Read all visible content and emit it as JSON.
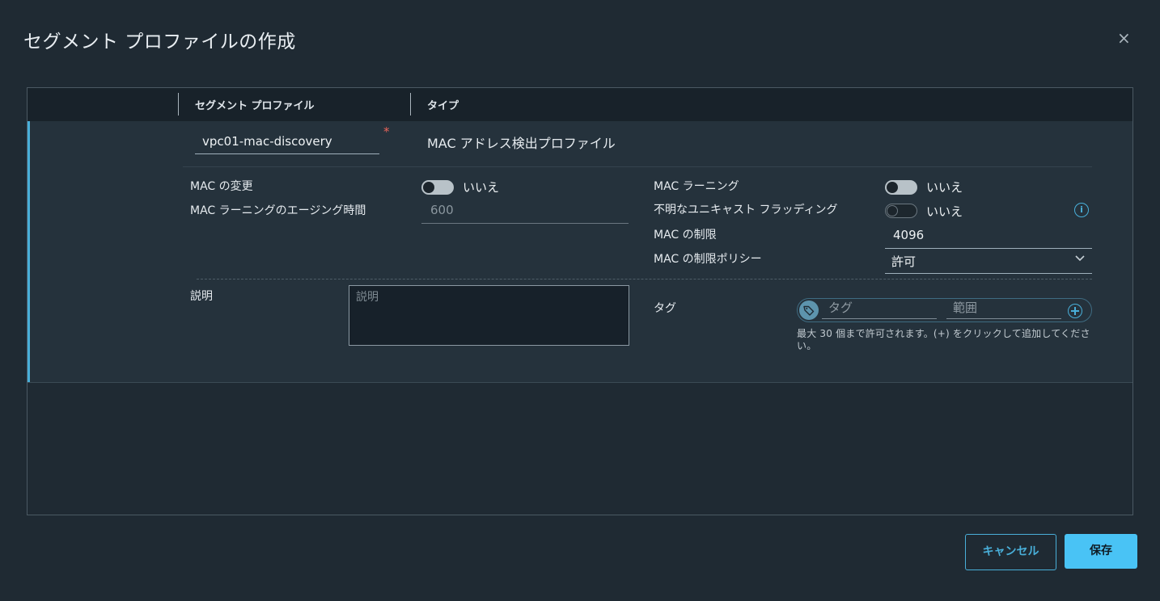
{
  "dialog": {
    "title": "セグメント プロファイルの作成",
    "close_glyph": "×"
  },
  "grid": {
    "columns": [
      "セグメント プロファイル",
      "タイプ"
    ],
    "row": {
      "name_value": "vpc01-mac-discovery",
      "required_marker": "*",
      "type": "MAC アドレス検出プロファイル"
    }
  },
  "settings": {
    "mac_change": {
      "label": "MAC の変更",
      "value": "いいえ"
    },
    "aging_time": {
      "label": "MAC ラーニングのエージング時間",
      "value": "600"
    },
    "mac_learning": {
      "label": "MAC ラーニング",
      "value": "いいえ"
    },
    "unknown_unicast": {
      "label": "不明なユニキャスト フラッディング",
      "value": "いいえ"
    },
    "mac_limit": {
      "label": "MAC の制限",
      "value": "4096"
    },
    "mac_limit_policy": {
      "label": "MAC の制限ポリシー",
      "value": "許可"
    }
  },
  "description": {
    "label": "説明",
    "placeholder": "説明"
  },
  "tags": {
    "label": "タグ",
    "tag_placeholder": "タグ",
    "scope_placeholder": "範囲",
    "hint": "最大 30 個まで許可されます。(+) をクリックして追加してください。"
  },
  "footer": {
    "cancel_label": "キャンセル",
    "save_label": "保存"
  },
  "icons": {
    "info": "i",
    "chevron": "⌄"
  },
  "colors": {
    "accent": "#49afd9",
    "primary_button": "#49c3f5",
    "required": "#e8645a"
  }
}
